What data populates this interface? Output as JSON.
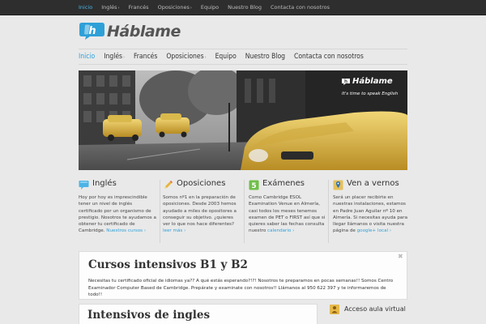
{
  "topbar": {
    "items": [
      {
        "label": "Inicio",
        "active": true,
        "caret": ""
      },
      {
        "label": "Inglés",
        "active": false,
        "caret": "›"
      },
      {
        "label": "Francés",
        "active": false,
        "caret": ""
      },
      {
        "label": "Oposiciones",
        "active": false,
        "caret": "›"
      },
      {
        "label": "Equipo",
        "active": false,
        "caret": ""
      },
      {
        "label": "Nuestro Blog",
        "active": false,
        "caret": ""
      },
      {
        "label": "Contacta con nosotros",
        "active": false,
        "caret": ""
      }
    ]
  },
  "logo": {
    "text": "Háblame",
    "icon": "speech-bubble-h-icon"
  },
  "mainnav": {
    "items": [
      {
        "label": "Inicio",
        "active": true,
        "caret": ""
      },
      {
        "label": "Inglés",
        "active": false,
        "caret": "›"
      },
      {
        "label": "Francés",
        "active": false,
        "caret": ""
      },
      {
        "label": "Oposiciones",
        "active": false,
        "caret": "›"
      },
      {
        "label": "Equipo",
        "active": false,
        "caret": ""
      },
      {
        "label": "Nuestro Blog",
        "active": false,
        "caret": ""
      },
      {
        "label": "Contacta con nosotros",
        "active": false,
        "caret": ""
      }
    ]
  },
  "hero": {
    "logo_text": "Háblame",
    "tagline": "It's time to speak English"
  },
  "features": [
    {
      "icon": "speech-bubble-icon",
      "title": "Inglés",
      "text": "Hoy por hoy es imprescindible tener un nivel de inglés certificado por un organismo de prestigio. Nosotros te ayudamos a obtener tu certificado de Cambridge.",
      "link": "Nuestros cursos ›"
    },
    {
      "icon": "pencil-icon",
      "title": "Oposiciones",
      "text": "Somos nº1 en la preparación de oposiciones. Desde 2003 hemos ayudado a miles de opositores a conseguir su objetivo. ¿quieres ver lo que nos hace diferentes?",
      "link": "leer más ›"
    },
    {
      "icon": "number-five-icon",
      "title": "Exámenes",
      "text": "Como Cambridge ESOL Examination Venue en Almería, casi todos los meses tenemos examen de PET o FIRST así que si quieres saber las fechas consulta nuestro",
      "link": "calendario ›"
    },
    {
      "icon": "map-pin-icon",
      "title": "Ven a vernos",
      "text": "Será un placer recibirte en nuestras instalaciones, estamos en Padre Juan Aguilar nº 10 en Almería. Si necesitas ayuda para llegar llámanos o visita nuestra página de",
      "link": "google+ local ›"
    }
  ],
  "notice": {
    "title": "Cursos intensivos B1 y B2",
    "text": "Necesitas tu certificado oficial de idiomas ya?? A qué estás esperando?!?! Nosotros te preparamos en pocas semanas!! Somos Centro Examinador Computer Based de Cambridge. Prepárate y examinate con nosotros!! Llámanos al 950 622 397 y te informaremos de todo!!",
    "close": "✖"
  },
  "bottom": {
    "main_title": "Intensivos de ingles",
    "side_title": "Acceso aula virtual"
  },
  "colors": {
    "accent": "#2ea0d8",
    "topbar": "#2e2e2e",
    "background": "#e9e9e9"
  }
}
